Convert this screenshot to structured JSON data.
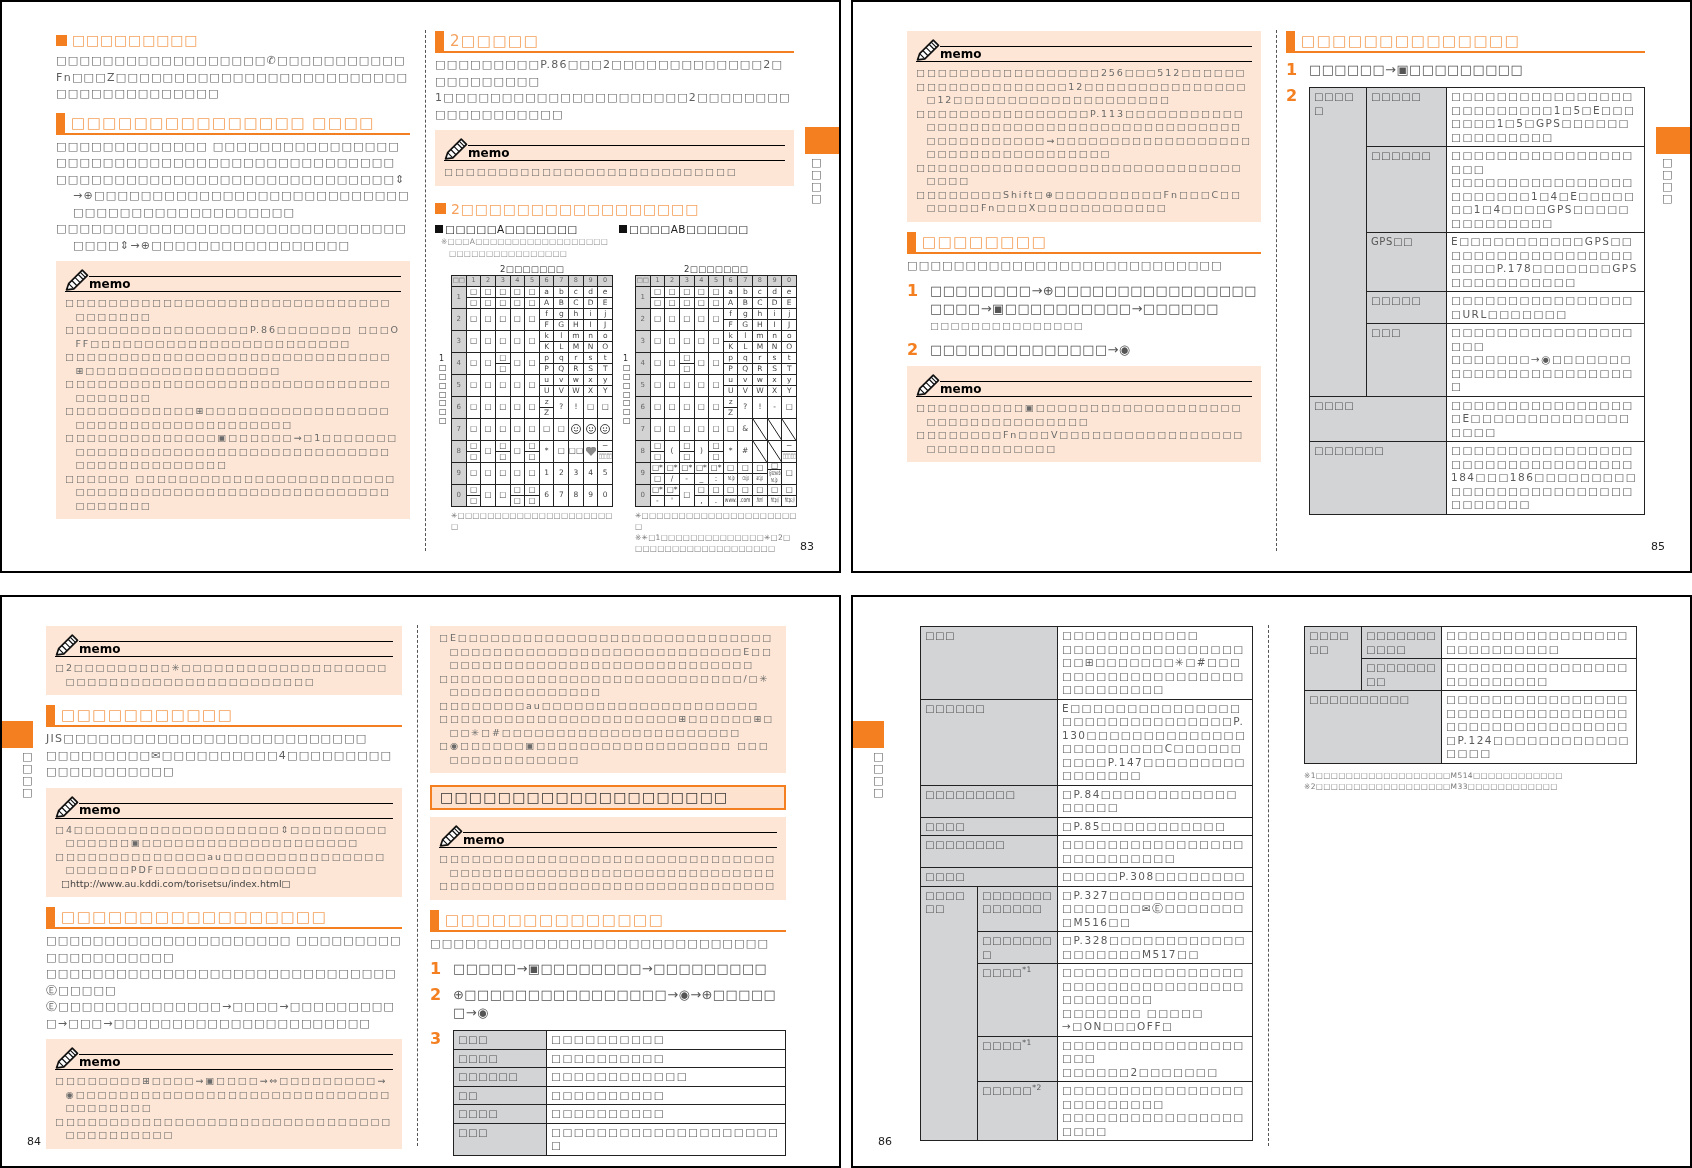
{
  "pages": [
    {
      "number": "83",
      "kind": "recto",
      "tab": "□□□□",
      "columns": [
        [
          {
            "kind": "topic",
            "text": "□□□□□□□□□"
          },
          {
            "kind": "text",
            "text": "□□□□□□□□□□□□□□□□□□✆□□□□□□□□□□□Fn□□□Z□□□□□□□□□□□□□□□□□□□□□□□□□□□□□□□□□□□□□□□"
          },
          {
            "kind": "section",
            "text": "□□□□□□□□□□□□□□□ □□□□"
          },
          {
            "kind": "text",
            "text": "□□□□□□□□□□□□□ □□□□□□□□□□□□□□□□□□□□□□□□□□□□□□□□□□□□□□□□□□□□□"
          },
          {
            "kind": "bullets",
            "items": [
              "□□□□□□□□□□□□□□□□□□□□□□□□□□□□□⇕→⊕□□□□□□□□□□□□□□□□□□□□□□□□□□□□□□□□□□□□□□□□□□□□□□",
              "□□□□□□□□□□□□□□□□□□□□□□□□□□□□□□□□□□⇕→⊕□□□□□□□□□□□□□□□□□"
            ]
          },
          {
            "kind": "memo",
            "header": "memo",
            "items": [
              "□□□□□□□□□□□□□□□□□□□□□□□□□□□□□□□□□□□□□",
              "□□□□□□□□□□□□□□□□□P.86□□□□□□□ □□□OFF□□□□□□□□□□□□□□□□□□□□□□□□",
              "□□□□□□□□□□□□□□□□□□□□□□□□□□□□□□⊞□□□□□□□□□□□□□□□□□□",
              "□□□□□□□□□□□□□□□□□□□□□□□□□□□□□□□□□□□□□",
              "□□□□□□□□□□□□⊞□□□□□□□□□□□□□□□□□□□□□□□□□□□□□□□□□□□□□",
              "□□□□□□□□□□□□□□▣□□□□□□→□1□□□□□□□□□□□□□□□□□□□□□□□□□□□□□□□□□□□□□□□□□□□□□□□□□□",
              "□□□□□□ □□□□□□□□□□□□□□□□□□□□□□□□□□□□□□□□□□□□□□□□□□□□□□□□□□□□□□□□□□□□"
            ]
          }
        ],
        [
          {
            "kind": "section",
            "text": "2□□□□□"
          },
          {
            "kind": "text",
            "text": "□□□□□□□□□P.86□□□2□□□□□□□□□□□□□2□□□□□□□□□□"
          },
          {
            "kind": "text",
            "text": "1□□□□□□□□□□□□□□□□□□□□□2□□□□□□□□□□□□□□□□□□□"
          },
          {
            "kind": "memo",
            "header": "memo",
            "items": [
              "□□□□□□□□□□□□□□□□□□□□□□□□□□□"
            ]
          },
          {
            "kind": "topic",
            "text": "2□□□□□□□□□□□□□□□□□"
          },
          {
            "kind": "keymaps",
            "maps": [
              {
                "title": "□□□□□A□□□□□□□",
                "note": "※□□□A□□□□□□□□□□□□□□□□□□□□□□□□□□□□□□□□□□",
                "caption": "2□□□□□□□",
                "axis": "1□□□□□□□",
                "header": [
                  "□□",
                  "1",
                  "2",
                  "3",
                  "4",
                  "5",
                  "6",
                  "7",
                  "8",
                  "9",
                  "0"
                ],
                "rows": [
                  {
                    "label": "1",
                    "cells": [
                      [
                        "□",
                        "□"
                      ],
                      [
                        "□",
                        "□"
                      ],
                      [
                        "□",
                        "□"
                      ],
                      [
                        "□",
                        "□"
                      ],
                      [
                        "□",
                        "□"
                      ],
                      [
                        "a",
                        "A"
                      ],
                      [
                        "b",
                        "B"
                      ],
                      [
                        "c",
                        "C"
                      ],
                      [
                        "d",
                        "D"
                      ],
                      [
                        "e",
                        "E"
                      ]
                    ]
                  },
                  {
                    "label": "2",
                    "cells": [
                      [
                        "□"
                      ],
                      [
                        "□"
                      ],
                      [
                        "□"
                      ],
                      [
                        "□"
                      ],
                      [
                        "□"
                      ],
                      [
                        "f",
                        "F"
                      ],
                      [
                        "g",
                        "G"
                      ],
                      [
                        "h",
                        "H"
                      ],
                      [
                        "i",
                        "I"
                      ],
                      [
                        "j",
                        "J"
                      ]
                    ]
                  },
                  {
                    "label": "3",
                    "cells": [
                      [
                        "□"
                      ],
                      [
                        "□"
                      ],
                      [
                        "□"
                      ],
                      [
                        "□"
                      ],
                      [
                        "□"
                      ],
                      [
                        "k",
                        "K"
                      ],
                      [
                        "l",
                        "L"
                      ],
                      [
                        "m",
                        "M"
                      ],
                      [
                        "n",
                        "N"
                      ],
                      [
                        "o",
                        "O"
                      ]
                    ]
                  },
                  {
                    "label": "4",
                    "cells": [
                      [
                        "□"
                      ],
                      [
                        "□"
                      ],
                      [
                        "□",
                        "□"
                      ],
                      [
                        "□"
                      ],
                      [
                        "□"
                      ],
                      [
                        "p",
                        "P"
                      ],
                      [
                        "q",
                        "Q"
                      ],
                      [
                        "r",
                        "R"
                      ],
                      [
                        "s",
                        "S"
                      ],
                      [
                        "t",
                        "T"
                      ]
                    ]
                  },
                  {
                    "label": "5",
                    "cells": [
                      [
                        "□"
                      ],
                      [
                        "□"
                      ],
                      [
                        "□"
                      ],
                      [
                        "□"
                      ],
                      [
                        "□"
                      ],
                      [
                        "u",
                        "U"
                      ],
                      [
                        "v",
                        "V"
                      ],
                      [
                        "w",
                        "W"
                      ],
                      [
                        "x",
                        "X"
                      ],
                      [
                        "y",
                        "Y"
                      ]
                    ]
                  },
                  {
                    "label": "6",
                    "cells": [
                      [
                        "□"
                      ],
                      [
                        "□"
                      ],
                      [
                        "□"
                      ],
                      [
                        "□"
                      ],
                      [
                        "□"
                      ],
                      [
                        "z",
                        "Z"
                      ],
                      [
                        "?"
                      ],
                      [
                        "!"
                      ],
                      [
                        "□"
                      ],
                      [
                        "□"
                      ]
                    ]
                  },
                  {
                    "label": "7",
                    "cells": [
                      [
                        "□"
                      ],
                      [
                        "□"
                      ],
                      [
                        "□"
                      ],
                      [
                        "□"
                      ],
                      [
                        "□"
                      ],
                      [
                        "□"
                      ],
                      [
                        "□"
                      ],
                      {
                        "kind": "emoji"
                      },
                      {
                        "kind": "emoji"
                      },
                      {
                        "kind": "emoji"
                      }
                    ]
                  },
                  {
                    "label": "8",
                    "cells": [
                      [
                        "□",
                        "□"
                      ],
                      [
                        "□"
                      ],
                      [
                        "□",
                        "□"
                      ],
                      [
                        "□"
                      ],
                      [
                        "□",
                        "□"
                      ],
                      [
                        "*"
                      ],
                      [
                        "□"
                      ],
                      [
                        "□□"
                      ],
                      {
                        "kind": "heart"
                      },
                      [
                        "−",
                        "□□□□□"
                      ]
                    ]
                  },
                  {
                    "label": "9",
                    "cells": [
                      [
                        "□"
                      ],
                      [
                        "□"
                      ],
                      [
                        "□"
                      ],
                      [
                        "□"
                      ],
                      [
                        "□"
                      ],
                      [
                        "1"
                      ],
                      [
                        "2"
                      ],
                      [
                        "3"
                      ],
                      [
                        "4"
                      ],
                      [
                        "5"
                      ]
                    ]
                  },
                  {
                    "label": "0",
                    "cells": [
                      [
                        "□",
                        "□"
                      ],
                      [
                        "□"
                      ],
                      [
                        "□"
                      ],
                      [
                        "□",
                        "□"
                      ],
                      [
                        "□",
                        "□"
                      ],
                      [
                        "6"
                      ],
                      [
                        "7"
                      ],
                      [
                        "8"
                      ],
                      [
                        "9"
                      ],
                      [
                        "0"
                      ]
                    ]
                  }
                ],
                "notes": [
                  "✳□□□□□□□□□□□□□□□□□□□□□□"
                ]
              },
              {
                "title": "□□□□AB□□□□□□",
                "caption": "2□□□□□□□",
                "axis": "1□□□□□□□",
                "header": [
                  "□□",
                  "1",
                  "2",
                  "3",
                  "4",
                  "5",
                  "6",
                  "7",
                  "8",
                  "9",
                  "0"
                ],
                "rows": [
                  {
                    "label": "1",
                    "cells": [
                      [
                        "□",
                        "□"
                      ],
                      [
                        "□",
                        "□"
                      ],
                      [
                        "□",
                        "□"
                      ],
                      [
                        "□",
                        "□"
                      ],
                      [
                        "□",
                        "□"
                      ],
                      [
                        "a",
                        "A"
                      ],
                      [
                        "b",
                        "B"
                      ],
                      [
                        "c",
                        "C"
                      ],
                      [
                        "d",
                        "D"
                      ],
                      [
                        "e",
                        "E"
                      ]
                    ]
                  },
                  {
                    "label": "2",
                    "cells": [
                      [
                        "□"
                      ],
                      [
                        "□"
                      ],
                      [
                        "□"
                      ],
                      [
                        "□"
                      ],
                      [
                        "□"
                      ],
                      [
                        "f",
                        "F"
                      ],
                      [
                        "g",
                        "G"
                      ],
                      [
                        "h",
                        "H"
                      ],
                      [
                        "i",
                        "I"
                      ],
                      [
                        "j",
                        "J"
                      ]
                    ]
                  },
                  {
                    "label": "3",
                    "cells": [
                      [
                        "□"
                      ],
                      [
                        "□"
                      ],
                      [
                        "□"
                      ],
                      [
                        "□"
                      ],
                      [
                        "□"
                      ],
                      [
                        "k",
                        "K"
                      ],
                      [
                        "l",
                        "L"
                      ],
                      [
                        "m",
                        "M"
                      ],
                      [
                        "n",
                        "N"
                      ],
                      [
                        "o",
                        "O"
                      ]
                    ]
                  },
                  {
                    "label": "4",
                    "cells": [
                      [
                        "□"
                      ],
                      [
                        "□"
                      ],
                      [
                        "□",
                        "□"
                      ],
                      [
                        "□"
                      ],
                      [
                        "□"
                      ],
                      [
                        "p",
                        "P"
                      ],
                      [
                        "q",
                        "Q"
                      ],
                      [
                        "r",
                        "R"
                      ],
                      [
                        "s",
                        "S"
                      ],
                      [
                        "t",
                        "T"
                      ]
                    ]
                  },
                  {
                    "label": "5",
                    "cells": [
                      [
                        "□"
                      ],
                      [
                        "□"
                      ],
                      [
                        "□"
                      ],
                      [
                        "□"
                      ],
                      [
                        "□"
                      ],
                      [
                        "u",
                        "U"
                      ],
                      [
                        "v",
                        "V"
                      ],
                      [
                        "w",
                        "W"
                      ],
                      [
                        "x",
                        "X"
                      ],
                      [
                        "y",
                        "Y"
                      ]
                    ]
                  },
                  {
                    "label": "6",
                    "cells": [
                      [
                        "□"
                      ],
                      [
                        "□"
                      ],
                      [
                        "□"
                      ],
                      [
                        "□"
                      ],
                      [
                        "□"
                      ],
                      [
                        "z",
                        "Z"
                      ],
                      [
                        "?"
                      ],
                      [
                        "!"
                      ],
                      [
                        "-"
                      ],
                      [
                        "□"
                      ]
                    ]
                  },
                  {
                    "label": "7",
                    "cells": [
                      [
                        "□"
                      ],
                      [
                        "□"
                      ],
                      [
                        "□"
                      ],
                      [
                        "□"
                      ],
                      [
                        "□"
                      ],
                      [
                        "□"
                      ],
                      [
                        "&"
                      ],
                      {
                        "kind": "slash"
                      },
                      {
                        "kind": "slash"
                      },
                      {
                        "kind": "slash"
                      }
                    ]
                  },
                  {
                    "label": "8",
                    "cells": [
                      [
                        "□",
                        "□"
                      ],
                      [
                        "("
                      ],
                      [
                        "□",
                        "□"
                      ],
                      [
                        ")"
                      ],
                      [
                        "□",
                        "□"
                      ],
                      [
                        "*"
                      ],
                      [
                        "#"
                      ],
                      {
                        "kind": "slash"
                      },
                      {
                        "kind": "slash"
                      },
                      [
                        "−",
                        "□□□□□"
                      ]
                    ]
                  },
                  {
                    "label": "9",
                    "cells": [
                      [
                        "□*",
                        "□"
                      ],
                      [
                        "□*",
                        "/"
                      ],
                      [
                        "□*",
                        "-"
                      ],
                      [
                        "□*",
                        "_"
                      ],
                      [
                        "□*",
                        ":"
                      ],
                      [
                        "□",
                        "ne.jp"
                      ],
                      [
                        "□",
                        "co.jp"
                      ],
                      [
                        "□",
                        "ac.jp"
                      ],
                      [
                        "□",
                        "@ezweb",
                        "ne.jp"
                      ],
                      [
                        "□"
                      ]
                    ]
                  },
                  {
                    "label": "0",
                    "cells": [
                      [
                        "□*",
                        "-"
                      ],
                      [
                        "□*",
                        "'"
                      ],
                      [
                        "□"
                      ],
                      [
                        "□",
                        ","
                      ],
                      [
                        "□",
                        "."
                      ],
                      [
                        "□",
                        "www."
                      ],
                      [
                        "□",
                        ".com"
                      ],
                      [
                        "□",
                        ".html"
                      ],
                      [
                        "□",
                        "http://"
                      ],
                      [
                        "□",
                        "https://"
                      ]
                    ]
                  }
                ],
                "notes": [
                  "✳□□□□□□□□□□□□□□□□□□□□□□",
                  "※✳□1□□□□□□□□□□□□□□✳□2□□□□□□□□□□□□□□□□□□□□"
                ]
              }
            ]
          }
        ]
      ]
    },
    {
      "number": "85",
      "kind": "recto",
      "tab": "□□□□",
      "columns": [
        [
          {
            "kind": "memo",
            "header": "memo",
            "items": [
              "□□□□□□□□□□□□□□□□□256□□□512□□□□□□",
              "□□□□□□□□□□□□□□12□□□□□□□□□□□□□□□□12□□□□□□□□□□□□□□□□□□□□",
              "□□□□□□□□□□□□□□□□P.113□□□□□□□□□□□□□□□□□□□□□□□□□□□□□□□□□□□□□□□□□□□□□□□□□□□→□□□□□□□□□□□□□□□□□□□□□□□□□□□□□□□□□□□",
              "□□□□□□□□□□□□□□□□□□□□□□□□□□□□□□□□□□",
              "□□□□□□□□Shift□⊕□□□□□□□□□□Fn□□□C□□□□□□□Fn□□□X□□□□□□□□□□□□"
            ]
          },
          {
            "kind": "section",
            "text": "□□□□□□□□"
          },
          {
            "kind": "text",
            "text": "□□□□□□□□□□□□□□□□□□□□□□□□□□□"
          },
          {
            "kind": "step",
            "number": "1",
            "text": "□□□□□□□□→⊕□□□□□□□□□□□□□□□□□□□□→▣□□□□□□□□□□→□□□□□□",
            "note": "□□□□□□□□□□□□□□□"
          },
          {
            "kind": "step",
            "number": "2",
            "text": "□□□□□□□□□□□□□□→◉"
          },
          {
            "kind": "memo",
            "header": "memo",
            "items": [
              "□□□□□□□□□□▣□□□□□□□□□□□□□□□□□□□□□□□□□□□□□□□□□□",
              "□□□□□□□□Fn□□□V□□□□□□□□□□□□□□□□□□□□□□□□□□□□□"
            ]
          }
        ],
        [
          {
            "kind": "section",
            "text": "□□□□□□□□□□□□□□"
          },
          {
            "kind": "step",
            "number": "1",
            "text": "□□□□□□→▣□□□□□□□□□"
          },
          {
            "kind": "step",
            "number": "2",
            "table": {
              "rows": [
                {
                  "label": "□□□□□",
                  "items": [
                    {
                      "label": "□□□□□",
                      "desc": [
                        "□□□□□□□□□□□□□□□□□□□□□□□□□1□5□E□□□□□□□1□5□GPS□□□□□□□□□□□□□□□"
                      ]
                    },
                    {
                      "label": "□□□□□□",
                      "desc": [
                        "□□□□□□□□□□□□□□□□□□□",
                        "□□□□□□□□□□□□□□□□□□□□□□□1□4□E□□□□□□□1□4□□□□GPS□□□□□□□□□□□□□□"
                      ]
                    },
                    {
                      "label": "GPS□□",
                      "desc": [
                        "E□□□□□□□□□□□GPS□□□□□□□□□□□□□□□□□□□□□□P.178□□□□□□□GPS□□□□□□□□□□□"
                      ]
                    },
                    {
                      "label": "□□□□□",
                      "desc": [
                        "□□□□□□□□□□□□□□□□□URL□□□□□□□"
                      ]
                    },
                    {
                      "label": "□□□",
                      "desc": [
                        "□□□□□□□□□□□□□□□□□□□",
                        "□□□□□□□→◉□□□□□□□□□□□□□□□□□□□□□□□□"
                      ]
                    }
                  ]
                },
                {
                  "label": "□□□□",
                  "desc": [
                    "□□□□□□□□□□□□□□□□□E□□□□□□□□□□□□□□□□□□"
                  ]
                },
                {
                  "label": "□□□□□□□",
                  "desc": [
                    "□□□□□□□□□□□□□□□□□□□□□□□□□□□□□□□□184□□□186□□□□□□□□□□□□□□□□□□□□□□□□□□□□□□□□"
                  ]
                }
              ]
            }
          }
        ]
      ]
    },
    {
      "number": "84",
      "kind": "verso",
      "tab": "□□□□",
      "columns": [
        [
          {
            "kind": "memo",
            "header": "memo",
            "items": [
              "□2□□□□□□□□□✳□□□□□□□□□□□□□□□□□□□□□□□□□□□□□□□□□□□□□□□□□□"
            ]
          },
          {
            "kind": "section",
            "text": "□□□□□□□□□□□"
          },
          {
            "kind": "text",
            "text": "JIS□□□□□□□□□□□□□□□□□□□□□□□□□□"
          },
          {
            "kind": "text",
            "text": "□□□□□□□□□✉□□□□□□□□□□4□□□□□□□□□□□□□□□□□□□□"
          },
          {
            "kind": "memo",
            "header": "memo",
            "items": [
              "□4□□□□□□□□□□□□□□□□□□□⇕□□□□□□□□□□□□□□□▣□□□□□□□□□□□□□□□□□□□□",
              "□□□□□□□□□□□□□□au□□□□□□□□□□□□□□□□□□□□□PDF□□□□□□□□□□□□□□□",
              {
                "kind": "url",
                "text": "□http://www.au.kddi.com/torisetsu/index.html□"
              }
            ]
          },
          {
            "kind": "section",
            "text": "□□□□□□□□□□□□□□□□□"
          },
          {
            "kind": "text",
            "text": "□□□□□□□□□□□□□□□□□□□□□ □□□□□□□□□□□□□□□□□□□□"
          },
          {
            "kind": "text",
            "text": "□□□□□□□□□□□□□□□□□□□□□□□□□□□□□□Ⓔ□□□□□"
          },
          {
            "kind": "text",
            "text": "Ⓔ□□□□□□□□□□□□□□→□□□□→□□□□□□□□□□→□□□→□□□□□□□□□□□□□□□□□□□□□□"
          },
          {
            "kind": "memo",
            "header": "memo",
            "items": [
              "□□□□□□□□⊞□□□□→▣□□□□→⇔□□□□□□□□□→◉□□□□□□□□□□□□□□□□□□□□□□□□□□□□□□□□□□□□□",
              "□□□□□□□□□□□□□□□□□□□□□□□□□□□□□□□□□□□□□□□□□"
            ]
          }
        ],
        [
          {
            "kind": "memo",
            "items": [
              "□E□□□□□□□□□□□□□□□□□□□□□□□□□□□□□□□□□□□□□□□□□□□□□□□□□□□□□□□□E□□□□□□□□□□□□□□□□□□□□□□□□□□□□□□",
              "□□□□□□□□□□□□□□□□□□□□□□□□□□□□/□✳□□□□□□□□□□□□□□",
              "□□□□□□□□au□□□□□□□□□□□□□□□□□□□□",
              "□□□□□□□□□□□□□□□□□□□□□□⊞□□□□□□⊞□□□✳□#□□□□□□□□□□□□□□□□□□□□□□",
              "□◉□□□□□□▣□□□□□□□□□□□□□□□□□□ □□□□□□□□□□□□□□□"
            ]
          },
          {
            "kind": "banner",
            "text": "□□□□□□□□□□□□□□□□□□□□"
          },
          {
            "kind": "memo",
            "header": "memo",
            "items": [
              "□□□□□□□□□□□□□□□□□□□□□□□□□□□□□□□□□□□□□□□□□□□□□□□□□□□□□□□□□□□□□",
              "□□□□□□□□□□□□□□□□□□□□□□□□□□□□□□□"
            ]
          },
          {
            "kind": "section",
            "text": "□□□□□□□□□□□□□□"
          },
          {
            "kind": "text",
            "text": "□□□□□□□□□□□□□□□□□□□□□□□□□□□□□"
          },
          {
            "kind": "step",
            "number": "1",
            "text": "□□□□□→▣□□□□□□□□→□□□□□□□□□"
          },
          {
            "kind": "step",
            "number": "2",
            "text": "⊕□□□□□□□□□□□□□□□□→◉→⊕□□□□□□→◉"
          },
          {
            "kind": "step",
            "number": "3",
            "table": {
              "rows": [
                {
                  "label": "□□□",
                  "desc": [
                    "□□□□□□□□□□"
                  ]
                },
                {
                  "label": "□□□□",
                  "desc": [
                    "□□□□□□□□□□"
                  ]
                },
                {
                  "label": "□□□□□□",
                  "desc": [
                    "□□□□□□□□□□□□"
                  ]
                },
                {
                  "label": "□□",
                  "desc": [
                    "□□□□□□□□□□"
                  ]
                },
                {
                  "label": "□□□□",
                  "desc": [
                    "□□□□□□□□□□"
                  ]
                },
                {
                  "label": "□□□",
                  "desc": [
                    "□□□□□□□□□□□□□□□□□□□□□"
                  ]
                }
              ]
            }
          }
        ]
      ]
    },
    {
      "number": "86",
      "kind": "verso",
      "tab": "□□□□",
      "columns": [
        [
          {
            "kind": "table",
            "rows": [
              {
                "label": "□□□",
                "desc": [
                  "□□□□□□□□□□□□",
                  "□□□□□□□□□□□□□□□□□□⊞□□□□□□□✳□#□□□□□□□□□□□□□□□□□□□□□□□□□□□□"
                ]
              },
              {
                "label": "□□□□□□",
                "desc": [
                  "E□□□□□□□□□□□□□□□□□□□□□□□□□□□□□□P.130□□□□□□□□□□□□□□□□□□□□□□□C□□□□□□□□□□P.147□□□□□□□□□□□□□□□□"
                ]
              },
              {
                "label": "□□□□□□□□□",
                "desc": [
                  "□P.84□□□□□□□□□□□□□□□□□"
                ]
              },
              {
                "label": "□□□□",
                "desc": [
                  "□P.85□□□□□□□□□□□"
                ]
              },
              {
                "label": "□□□□□□□□",
                "desc": [
                  "□□□□□□□□□□□□□□□□□□□□□□□□□□"
                ]
              },
              {
                "label": "□□□□",
                "desc": [
                  "□□□□□P.308□□□□□□□□"
                ]
              },
              {
                "label": "□□□□□□",
                "items": [
                  {
                    "label": "□□□□□□□□□□□□□",
                    "desc": [
                      "□P.327□□□□□□□□□□□□□□□□□□□✉Ⓔ□□□□□□□□M516□□"
                    ]
                  },
                  {
                    "label": "□□□□□□□□",
                    "desc": [
                      "□P.328□□□□□□□□□□□□□□□□□□□M517□□"
                    ]
                  },
                  {
                    "label": "□□□□$^{*1}$",
                    "desc": [
                      "□□□□□□□□□□□□□□□□□□□□□□□□□□□□□□□□□□□□□□□□",
                      "□□□□□□□ □□□□□",
                      "→□ON□□□OFF□"
                    ]
                  },
                  {
                    "label": "□□□□$^{*1}$",
                    "desc": [
                      "□□□□□□□□□□□□□□□□□□□",
                      "□□□□□□2□□□□□□□"
                    ]
                  },
                  {
                    "label": "□□□□□$^{*2}$",
                    "desc": [
                      "□□□□□□□□□□□□□□□□□□□□□□□□□",
                      "□□□□□□□□□□□□□□□□□□□□"
                    ]
                  }
                ]
              }
            ]
          }
        ],
        [
          {
            "kind": "table",
            "rows": [
              {
                "label": "□□□□□□",
                "items": [
                  {
                    "label": "□□□□□□□□□□□",
                    "desc": [
                      "□□□□□□□□□□□□□□□□□□□□□□□□□□"
                    ]
                  },
                  {
                    "label": "□□□□□□□□□",
                    "desc": [
                      "□□□□□□□□□□□□□□□□□□□□□□□□□"
                    ]
                  }
                ]
              },
              {
                "label": "□□□□□□□□□□",
                "desc": [
                  "□□□□□□□□□□□□□□□□□□□□□□□□□□□□□□□□□□□□□□□□□□□□□□□□□P.124□□□□□□□□□□□□□□□□"
                ]
              }
            ]
          },
          {
            "kind": "footnotes",
            "items": [
              "※1□□□□□□□□□□□□□□□□□□M514□□□□□□□□□□□□",
              "※2□□□□□□□□□□□□□□□□□□M33□□□□□□□□□□□□"
            ]
          }
        ]
      ]
    }
  ]
}
